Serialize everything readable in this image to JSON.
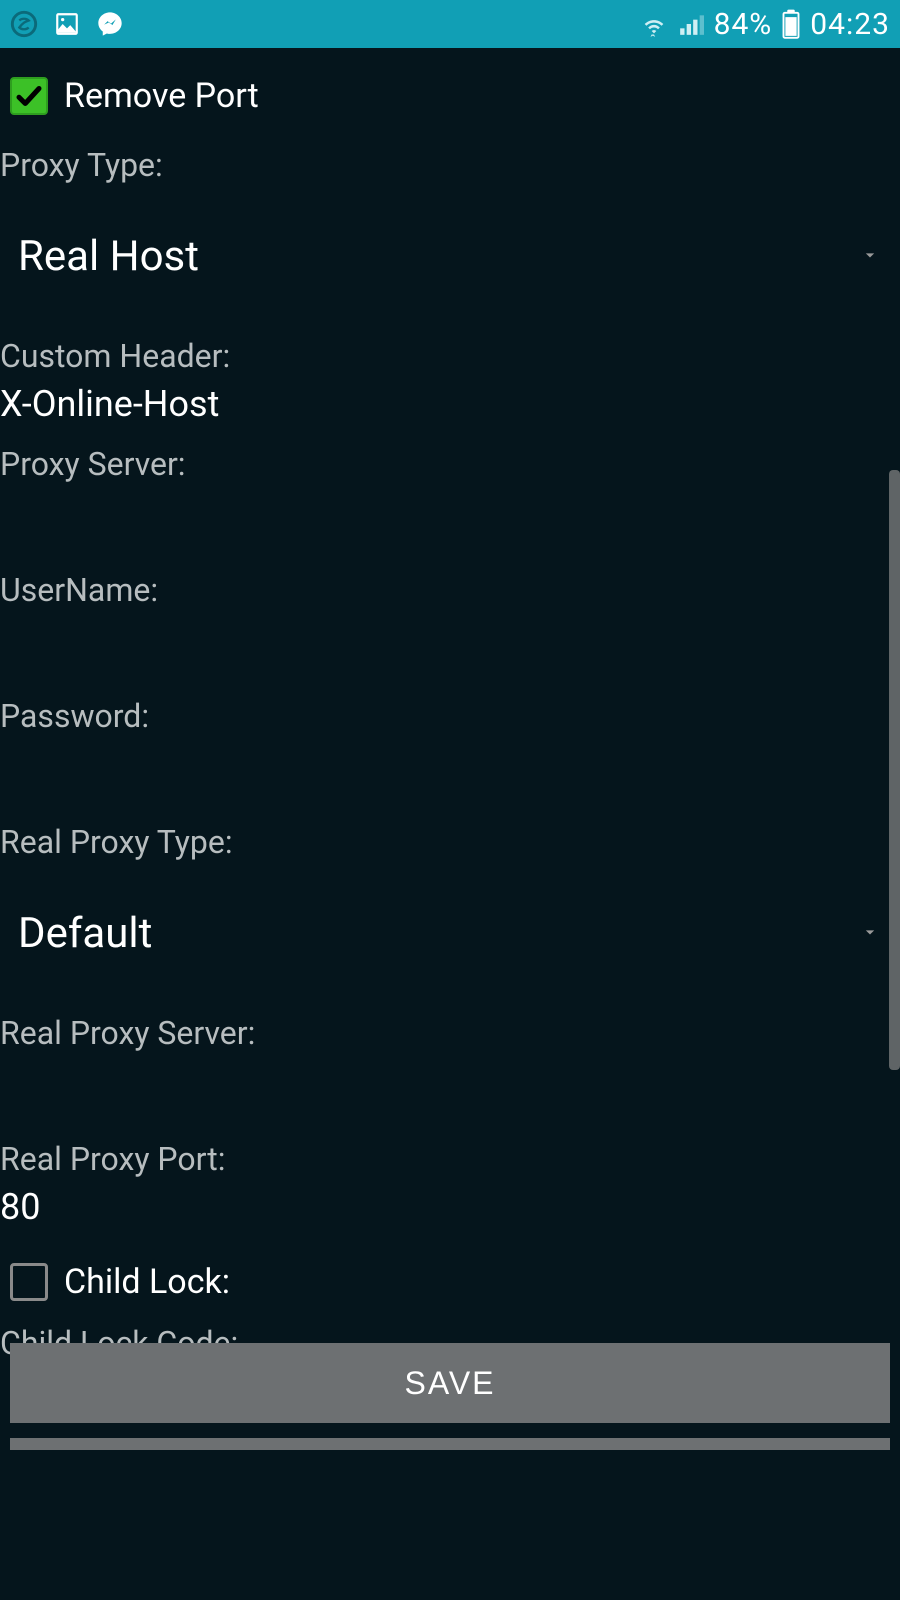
{
  "status": {
    "battery": "84%",
    "time": "04:23"
  },
  "form": {
    "remove_port_label": "Remove Port",
    "remove_port_checked": true,
    "proxy_type_label": "Proxy Type:",
    "proxy_type_value": "Real Host",
    "custom_header_label": "Custom Header:",
    "custom_header_value": "X-Online-Host",
    "proxy_server_label": "Proxy Server:",
    "proxy_server_value": "",
    "username_label": "UserName:",
    "username_value": "",
    "password_label": "Password:",
    "password_value": "",
    "real_proxy_type_label": "Real Proxy Type:",
    "real_proxy_type_value": "Default",
    "real_proxy_server_label": "Real Proxy Server:",
    "real_proxy_server_value": "",
    "real_proxy_port_label": "Real Proxy Port:",
    "real_proxy_port_value": "80",
    "child_lock_label": "Child Lock:",
    "child_lock_checked": false,
    "child_lock_code_label": "Child Lock Code:",
    "child_lock_code_value": "",
    "save_button": "SAVE"
  }
}
